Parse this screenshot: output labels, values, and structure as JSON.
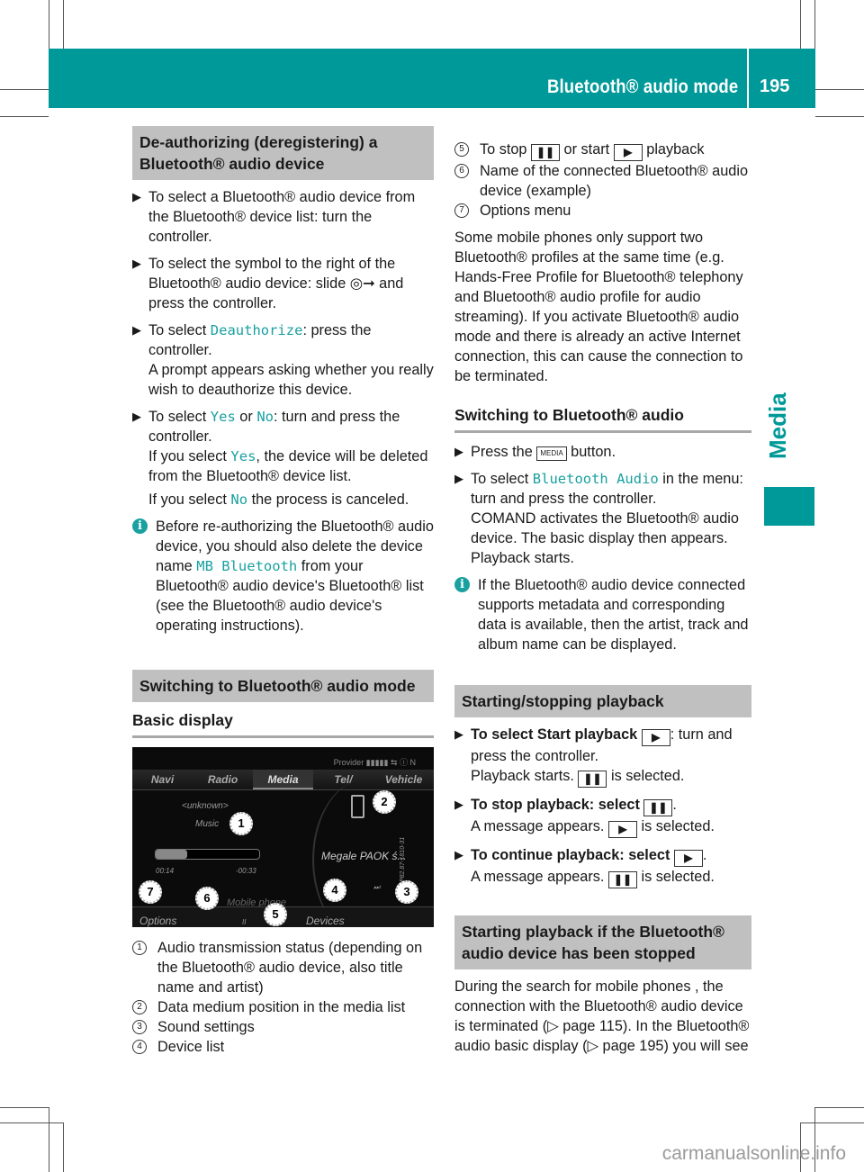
{
  "header": {
    "title": "Bluetooth® audio mode",
    "page_number": "195"
  },
  "side_tab": {
    "label": "Media"
  },
  "colors": {
    "brand_teal": "#009999",
    "highlight_text": "#1aa0a0",
    "section_gray": "#c0c0c0"
  },
  "left": {
    "section1": {
      "heading": "De-authorizing (deregistering) a Bluetooth® audio device",
      "steps": [
        {
          "text": "To select a Bluetooth® audio device from the Bluetooth® device list: turn the controller."
        },
        {
          "text_a": "To select the symbol to the right of the Bluetooth® audio device: slide ",
          "icon": "◎➞",
          "text_b": " and press the controller."
        },
        {
          "text_a": "To select ",
          "hl": "Deauthorize",
          "text_b": ": press the controller.",
          "result": "A prompt appears asking whether you really wish to deauthorize this device."
        },
        {
          "text_a": "To select ",
          "hl1": "Yes",
          "mid": " or ",
          "hl2": "No",
          "text_b": ": turn and press the controller.",
          "result_a": "If you select ",
          "result_hl": "Yes",
          "result_b": ", the device will be deleted from the Bluetooth® device list.",
          "result2_a": "If you select ",
          "result2_hl": "No",
          "result2_b": " the process is canceled."
        }
      ],
      "info": {
        "text_a": "Before re-authorizing the Bluetooth® audio device, you should also delete the device name ",
        "hl": "MB Bluetooth",
        "text_b": " from your Bluetooth® audio device's Bluetooth® list (see the Bluetooth® audio device's operating instructions)."
      }
    },
    "section2": {
      "heading": "Switching to Bluetooth® audio mode",
      "subheading": "Basic display",
      "display": {
        "status_bar": "Provider ▮▮▮▮▮ ⇆ ⓘ N",
        "tabs": [
          "Navi",
          "Radio",
          "Media",
          "Tel/",
          "Vehicle"
        ],
        "active_tab": "Media",
        "line1": "<unknown>",
        "line2": "Music",
        "track": "Megale PAOK ś...",
        "elapsed": "00:14",
        "remaining": "-00:33",
        "progress": 0.3,
        "device_name": "Mobile phone",
        "bottom_left": "Options",
        "bottom_right": "Devices",
        "pause_glyph": "II",
        "skip_back": "⏮",
        "skip_fwd": "⏭",
        "image_id_text": "P82.87-1810-31",
        "callouts": [
          "1",
          "2",
          "3",
          "4",
          "5",
          "6",
          "7"
        ]
      },
      "legend": [
        {
          "num": "1",
          "text": "Audio transmission status (depending on the Bluetooth® audio device, also title name and artist)"
        },
        {
          "num": "2",
          "text": "Data medium position in the media list"
        },
        {
          "num": "3",
          "text": "Sound settings"
        },
        {
          "num": "4",
          "text": "Device list"
        }
      ]
    }
  },
  "right": {
    "legend": [
      {
        "num": "5",
        "text_a": "To stop ",
        "btn1": "❚❚",
        "mid": " or start ",
        "btn2": "▶",
        "text_b": " playback"
      },
      {
        "num": "6",
        "text": "Name of the connected Bluetooth® audio device (example)"
      },
      {
        "num": "7",
        "text": "Options menu"
      }
    ],
    "para1": "Some mobile phones only support two Bluetooth® profiles at the same time (e.g. Hands-Free Profile for Bluetooth® telephony and Bluetooth® audio profile for audio streaming). If you activate Bluetooth® audio mode and there is already an active Internet connection, this can cause the connection to be terminated.",
    "section3": {
      "heading": "Switching to Bluetooth® audio",
      "steps": [
        {
          "text_a": "Press the ",
          "key": "MEDIA",
          "text_b": " button."
        },
        {
          "text_a": "To select ",
          "hl": "Bluetooth Audio",
          "text_b": " in the menu: turn and press the controller.",
          "result": "COMAND activates the Bluetooth® audio device. The basic display then appears. Playback starts."
        }
      ],
      "info": "If the Bluetooth® audio device connected supports metadata and corresponding data is available, then the artist, track and album name can be displayed."
    },
    "section4": {
      "heading": "Starting/stopping playback",
      "steps": [
        {
          "bold": "To select Start playback ",
          "btn": "▶",
          "text": ": turn and press the controller.",
          "result_a": "Playback starts. ",
          "result_btn": "❚❚",
          "result_b": " is selected."
        },
        {
          "bold": "To stop playback: select ",
          "btn": "❚❚",
          "text": ".",
          "result_a": "A message appears. ",
          "result_btn": "▶",
          "result_b": " is selected."
        },
        {
          "bold": "To continue playback: select ",
          "btn": "▶",
          "text": ".",
          "result_a": "A message appears. ",
          "result_btn": "❚❚",
          "result_b": " is selected."
        }
      ]
    },
    "section5": {
      "heading": "Starting playback if the Bluetooth® audio device has been stopped",
      "para": "During the search for mobile phones , the connection with the Bluetooth® audio device is terminated (▷ page 115). In the Bluetooth® audio basic display (▷ page 195) you will see"
    }
  },
  "watermark": "carmanualsonline.info"
}
